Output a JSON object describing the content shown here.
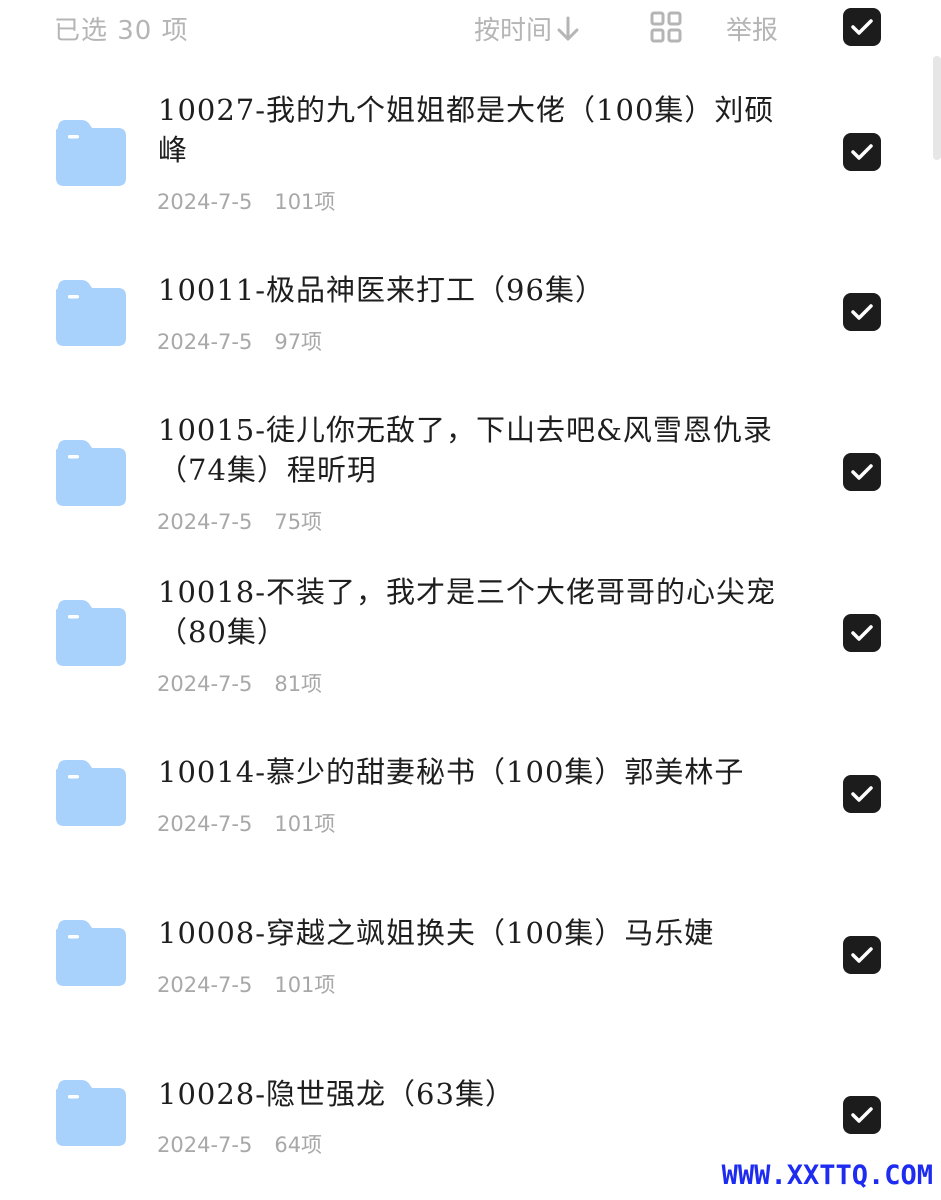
{
  "header": {
    "selected_count": "已选 30 项",
    "sort_label": "按时间",
    "sort_icon": "arrow-down-icon",
    "view_icon": "grid-view-icon",
    "report_label": "举报",
    "select_all_checked": true
  },
  "colors": {
    "checkbox": "#1c1c1c",
    "folder": "#a8d1fb",
    "muted_text": "#b5b5b5",
    "watermark": "#1d2cf0"
  },
  "folders": [
    {
      "title": "10027-我的九个姐姐都是大佬（100集）刘硕峰",
      "date": "2024-7-5",
      "count": "101项",
      "checked": true
    },
    {
      "title": "10011-极品神医来打工（96集）",
      "date": "2024-7-5",
      "count": "97项",
      "checked": true
    },
    {
      "title": "10015-徒儿你无敌了，下山去吧&风雪恩仇录（74集）程昕玥",
      "date": "2024-7-5",
      "count": "75项",
      "checked": true
    },
    {
      "title": "10018-不装了，我才是三个大佬哥哥的心尖宠（80集）",
      "date": "2024-7-5",
      "count": "81项",
      "checked": true
    },
    {
      "title": "10014-慕少的甜妻秘书（100集）郭美林子",
      "date": "2024-7-5",
      "count": "101项",
      "checked": true
    },
    {
      "title": "10008-穿越之飒姐换夫（100集）马乐婕",
      "date": "2024-7-5",
      "count": "101项",
      "checked": true
    },
    {
      "title": "10028-隐世强龙（63集）",
      "date": "2024-7-5",
      "count": "64项",
      "checked": true
    }
  ],
  "watermark": "WWW.XXTTQ.COM"
}
